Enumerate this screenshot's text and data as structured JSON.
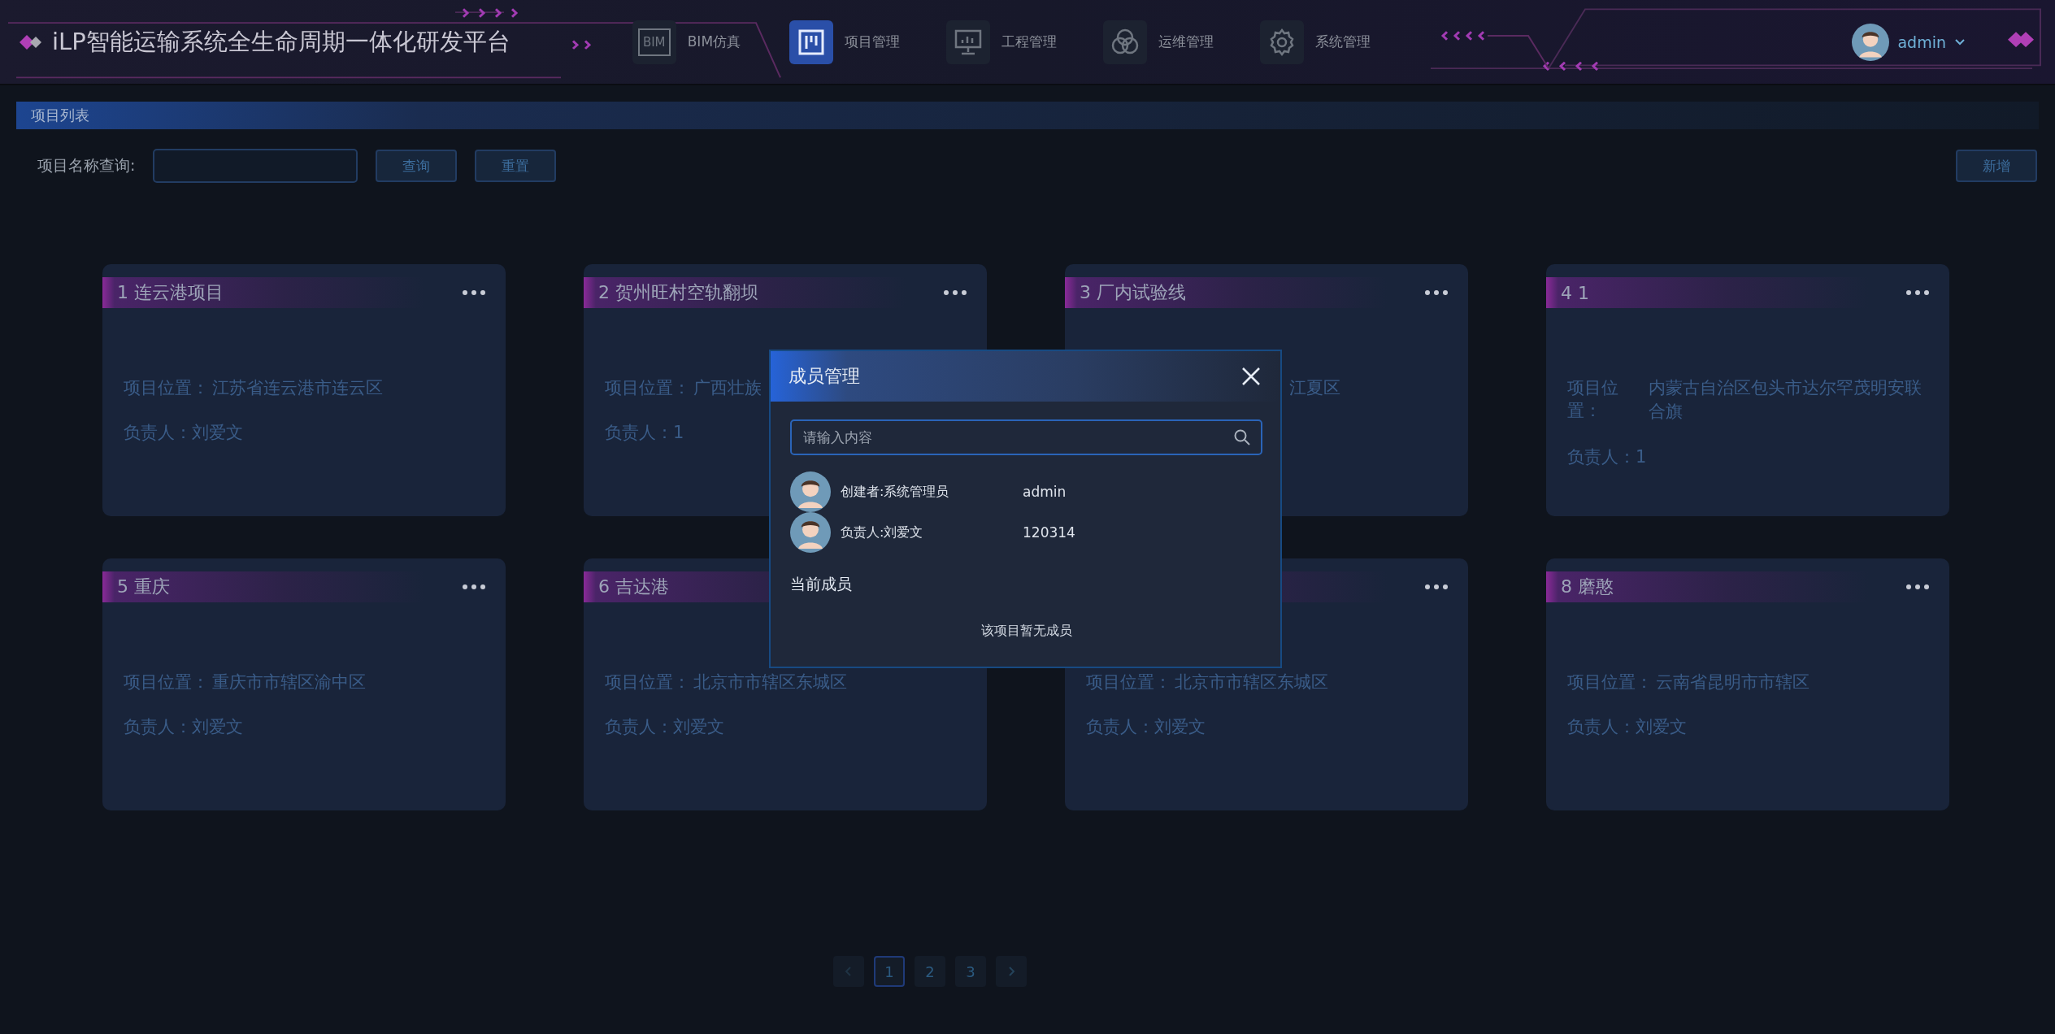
{
  "header": {
    "title": "iLP智能运输系统全生命周期一体化研发平台",
    "nav": [
      {
        "label": "BIM仿真",
        "kind": "bim",
        "icon_text": "BIM",
        "selected": false
      },
      {
        "label": "项目管理",
        "kind": "board",
        "selected": true
      },
      {
        "label": "工程管理",
        "kind": "monitor",
        "selected": false
      },
      {
        "label": "运维管理",
        "kind": "rings",
        "selected": false
      },
      {
        "label": "系统管理",
        "kind": "gear",
        "selected": false
      }
    ],
    "user": {
      "name": "admin"
    }
  },
  "section": {
    "title": "项目列表"
  },
  "search": {
    "label": "项目名称查询:",
    "buttons": [
      "查询",
      "重置"
    ],
    "add_button": "新增"
  },
  "cards": [
    {
      "title": "1 连云港项目",
      "menu": true,
      "location": {
        "label": "项目位置：",
        "value": "江苏省连云港市连云区"
      },
      "owner": "负责人：刘爱文"
    },
    {
      "title": "2 贺州旺村空轨翻坝",
      "menu": true,
      "location": {
        "label": "项目位置：",
        "value": "广西壮族"
      },
      "owner": "负责人：1"
    },
    {
      "title": "3 厂内试验线",
      "menu": true,
      "location": {
        "value": "江夏区",
        "clipped": true
      }
    },
    {
      "title": "4 1",
      "menu": true,
      "location": {
        "label": "项目位置：",
        "value": "内蒙古自治区包头市达尔罕茂明安联合旗"
      },
      "owner": "负责人：1"
    },
    {
      "title": "5 重庆",
      "menu": true,
      "location": {
        "label": "项目位置：",
        "value": "重庆市市辖区渝中区"
      },
      "owner": "负责人：刘爱文"
    },
    {
      "title": "6 吉达港",
      "location": {
        "label": "项目位置：",
        "value": "北京市市辖区东城区"
      },
      "owner": "负责人：刘爱文"
    },
    {
      "menu": true,
      "location": {
        "label": "项目位置：",
        "value": "北京市市辖区东城区"
      },
      "owner": "负责人：刘爱文"
    },
    {
      "title": "8 磨憨",
      "menu": true,
      "location": {
        "label": "项目位置：",
        "value": "云南省昆明市市辖区"
      },
      "owner": "负责人：刘爱文"
    }
  ],
  "pagination": {
    "pages": [
      {
        "label": "1",
        "selected": true
      },
      {
        "label": "2",
        "selected": false
      },
      {
        "label": "3",
        "selected": false
      }
    ]
  },
  "modal": {
    "title": "成员管理",
    "search_placeholder": "请输入内容",
    "people": [
      {
        "role": "创建者:系统管理员",
        "id": "admin"
      },
      {
        "role": "负责人:刘爱文",
        "id": "120314"
      }
    ],
    "section": "当前成员",
    "empty": "该项目暂无成员"
  }
}
